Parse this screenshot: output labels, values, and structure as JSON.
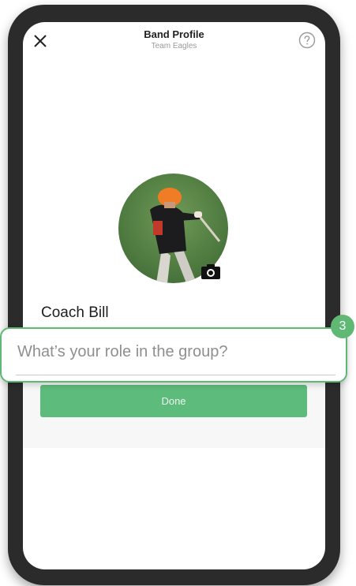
{
  "header": {
    "title": "Band Profile",
    "subtitle": "Team Eagles"
  },
  "profile": {
    "name": "Coach Bill"
  },
  "role_field": {
    "value": "",
    "placeholder": "What’s your role in the group?"
  },
  "done_button": {
    "label": "Done"
  },
  "step_badge": {
    "number": "3"
  },
  "icons": {
    "close": "close-icon",
    "help": "help-icon",
    "camera": "camera-icon"
  },
  "colors": {
    "accent": "#5fb974",
    "button": "#5dbb7b",
    "phone_frame": "#2b2b2b"
  }
}
